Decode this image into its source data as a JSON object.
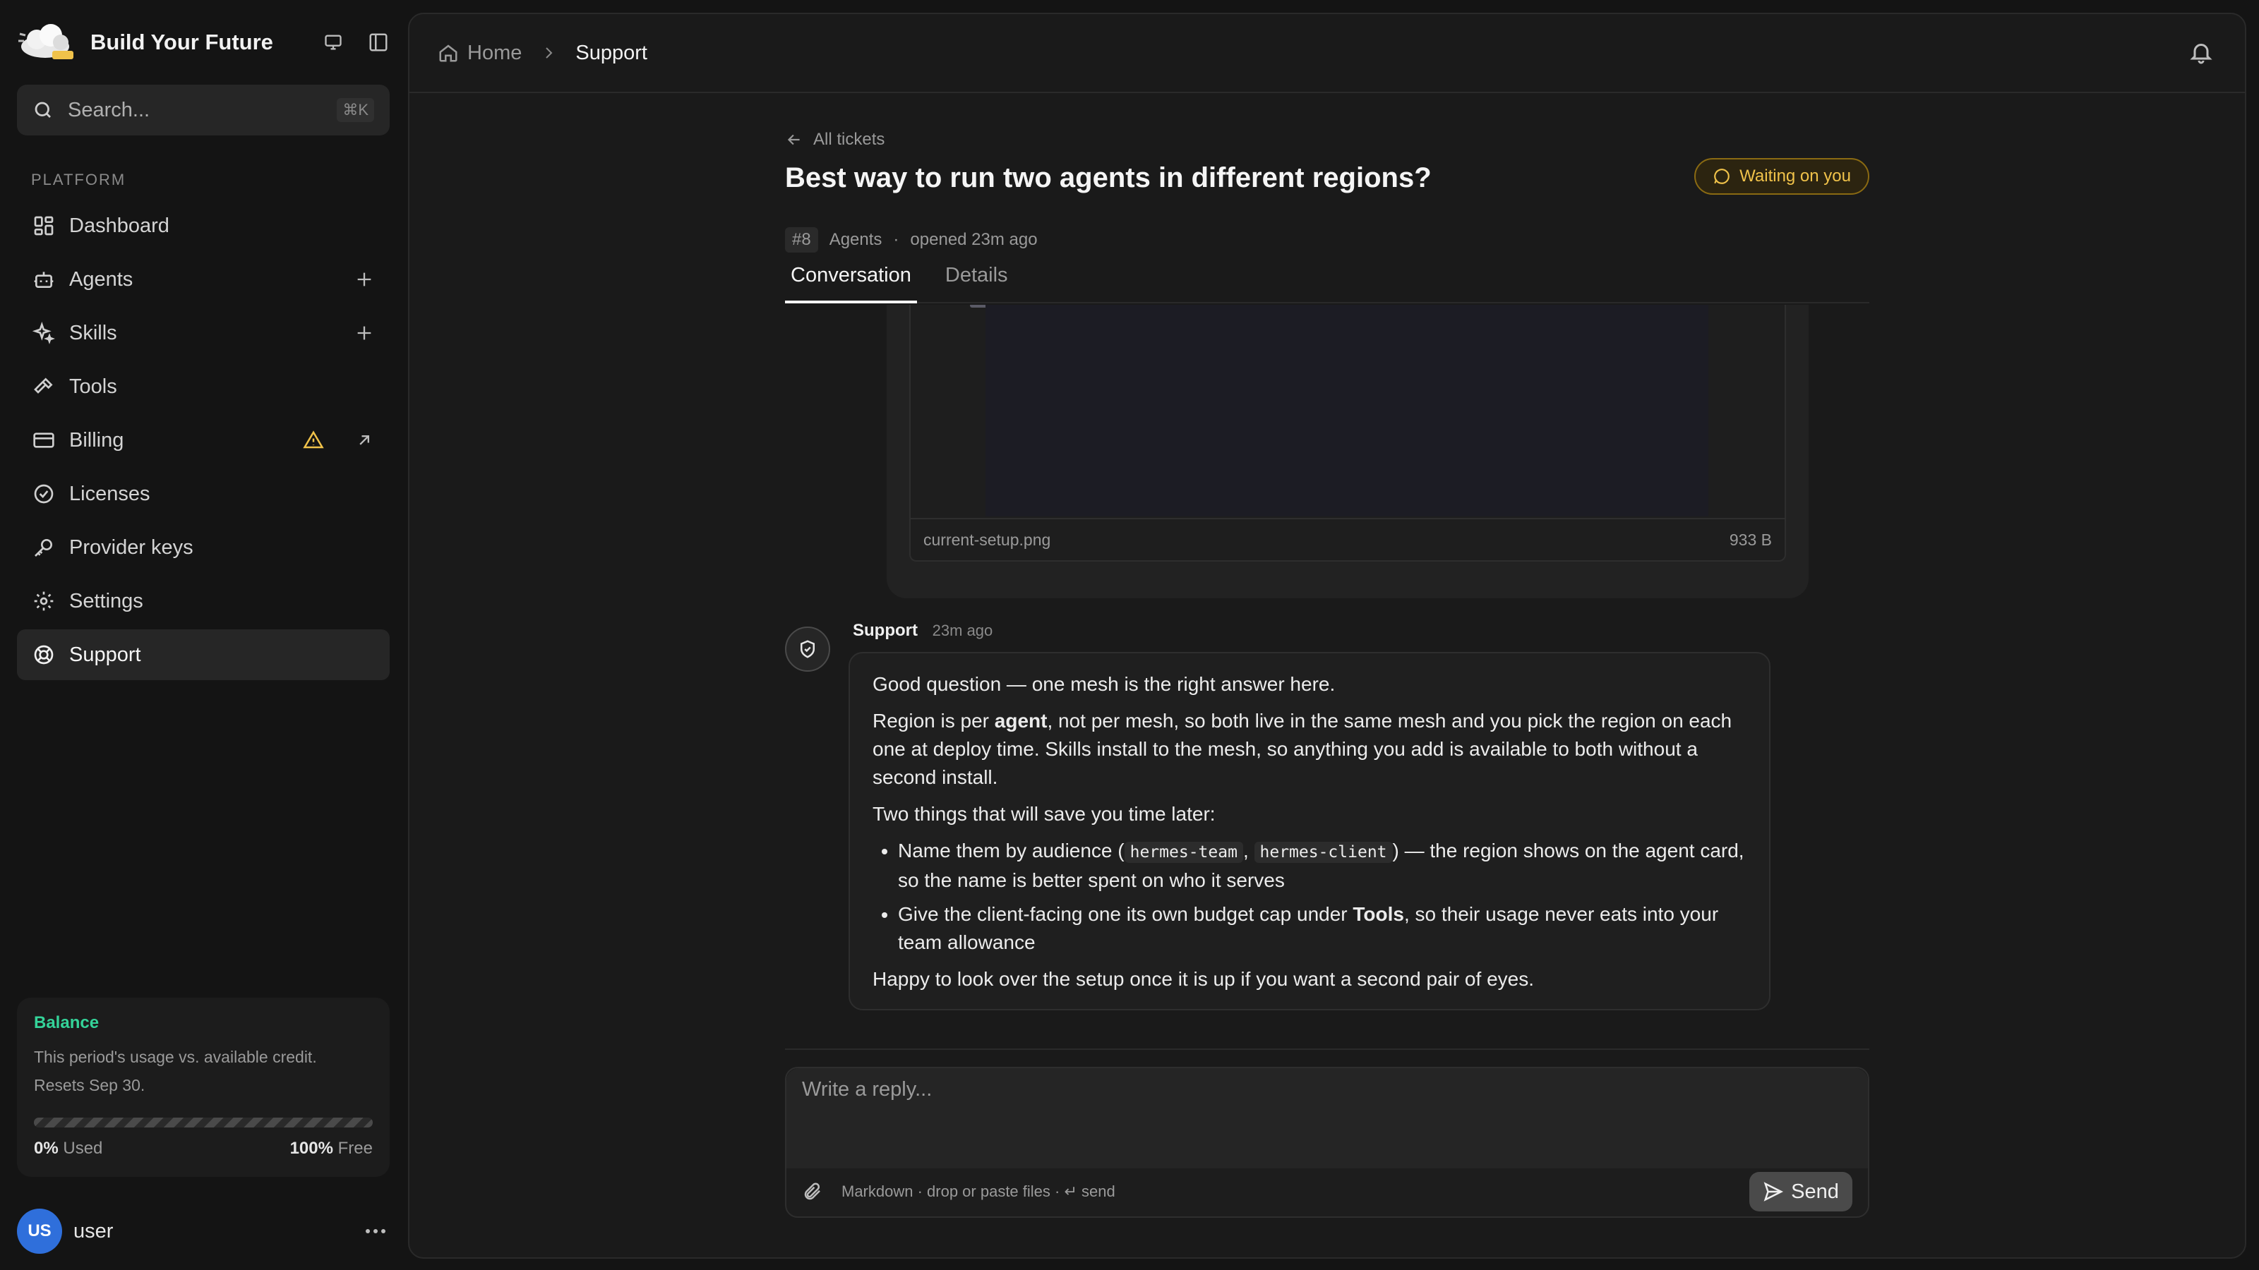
{
  "brand": {
    "name": "Build Your Future"
  },
  "search": {
    "placeholder": "Search...",
    "shortcut": "⌘K"
  },
  "sidebar": {
    "section": "PLATFORM",
    "items": [
      {
        "label": "Dashboard",
        "icon": "dashboard-icon"
      },
      {
        "label": "Agents",
        "icon": "bot-icon"
      },
      {
        "label": "Skills",
        "icon": "sparkles-icon"
      },
      {
        "label": "Tools",
        "icon": "hammer-icon"
      },
      {
        "label": "Billing",
        "icon": "credit-card-icon"
      },
      {
        "label": "Licenses",
        "icon": "check-circle-icon"
      },
      {
        "label": "Provider keys",
        "icon": "key-icon"
      },
      {
        "label": "Settings",
        "icon": "gear-icon"
      },
      {
        "label": "Support",
        "icon": "lifebuoy-icon",
        "active": true
      }
    ]
  },
  "balance": {
    "title": "Balance",
    "description": "This period's usage vs. available credit. Resets Sep 30.",
    "used_pct": "0%",
    "used_label": "Used",
    "free_pct": "100%",
    "free_label": "Free",
    "used_fraction": 0
  },
  "user": {
    "initials": "US",
    "name": "user"
  },
  "breadcrumb": {
    "home": "Home",
    "current": "Support"
  },
  "ticket": {
    "back_label": "All tickets",
    "title": "Best way to run two agents in different regions?",
    "status": "Waiting on you",
    "number": "#8",
    "category": "Agents",
    "opened": "opened 23m ago"
  },
  "tabs": [
    {
      "label": "Conversation",
      "active": true
    },
    {
      "label": "Details",
      "active": false
    }
  ],
  "attachment": {
    "filename": "current-setup.png",
    "size": "933 B"
  },
  "message": {
    "author": "Support",
    "time": "23m ago",
    "p1": "Good question — one mesh is the right answer here.",
    "p2_pre": "Region is per ",
    "p2_bold": "agent",
    "p2_post": ", not per mesh, so both live in the same mesh and you pick the region on each one at deploy time. Skills install to the mesh, so anything you add is available to both without a second install.",
    "p3": "Two things that will save you time later:",
    "b1_pre": "Name them by audience (",
    "b1_code1": "hermes-team",
    "b1_sep": ", ",
    "b1_code2": "hermes-client",
    "b1_post": ") — the region shows on the agent card, so the name is better spent on who it serves",
    "b2_pre": "Give the client-facing one its own budget cap under ",
    "b2_bold": "Tools",
    "b2_post": ", so their usage never eats into your team allowance",
    "p4": "Happy to look over the setup once it is up if you want a second pair of eyes."
  },
  "composer": {
    "placeholder": "Write a reply...",
    "hint": "Markdown · drop or paste files · ↵ send",
    "send_label": "Send"
  },
  "colors": {
    "accent_green": "#34d399",
    "status_amber": "#f0c24a",
    "avatar_blue": "#2f6fdb"
  }
}
